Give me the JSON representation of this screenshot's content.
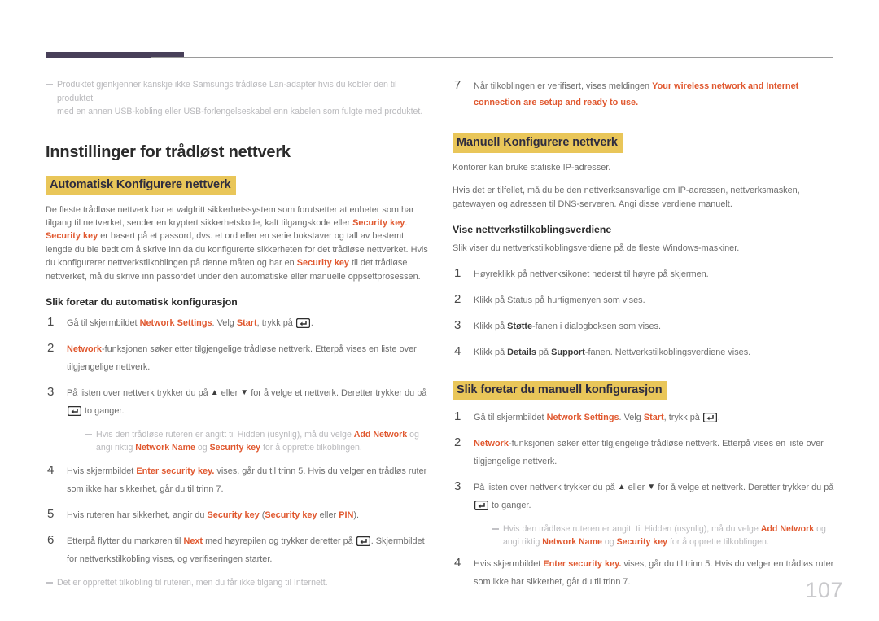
{
  "document": {
    "page_number": "107",
    "colors": {
      "accent": "#e0582f",
      "highlight_bg": "#e9c659",
      "highlight_text": "#2e2c3f",
      "rule_dark": "#484059",
      "rule_light": "#9a9a9a",
      "body_text": "#6d6d6d",
      "note_text": "#b9b9bc",
      "page_number": "#c9c9cc"
    },
    "icons": {
      "enter_key": "enter-key-icon",
      "arrow_up": "▲",
      "arrow_down": "▼",
      "note_dash": "note-dash-icon"
    }
  },
  "left_column": {
    "top_note": {
      "text_1": "Produktet gjenkjenner kanskje ikke Samsungs trådløse Lan-adapter hvis du kobler den til produktet",
      "text_2": "med en annen USB-kobling eller USB-forlengelseskabel enn kabelen som fulgte med produktet."
    },
    "title": "Innstillinger for trådløst nettverk",
    "section_heading": "Automatisk Konfigurere nettverk",
    "intro_paragraph": {
      "part_1": "De fleste trådløse nettverk har et valgfritt sikkerhetssystem som forutsetter at enheter som har tilgang til nettverket, sender en kryptert sikkerhetskode, kalt tilgangskode eller ",
      "term_1": "Security key",
      "part_2": ". ",
      "term_2": "Security key",
      "part_3": " er basert på et passord, dvs. et ord eller en serie bokstaver og tall av bestemt lengde du ble bedt om å skrive inn da du konfigurerte sikkerheten for det trådløse nettverket. Hvis du konfigurerer nettverkstilkoblingen på denne måten og har en ",
      "term_3": "Security key",
      "part_4": " til det trådløse nettverket, må du skrive inn passordet under den automatiske eller manuelle oppsettprosessen."
    },
    "subheading": "Slik foretar du automatisk konfigurasjon",
    "steps": {
      "s1": {
        "num": "1",
        "part_1": "Gå til skjermbildet ",
        "term_1": "Network Settings",
        "part_2": ". Velg ",
        "term_2": "Start",
        "part_3": ", trykk på ",
        "part_4": "."
      },
      "s2": {
        "num": "2",
        "term_1": "Network",
        "part_1": "-funksjonen søker etter tilgjengelige trådløse nettverk. Etterpå vises en liste over tilgjengelige nettverk."
      },
      "s3": {
        "num": "3",
        "part_1": "På listen over nettverk trykker du på ",
        "arrow_up": "▲",
        "part_2": " eller ",
        "arrow_down": "▼",
        "part_3": " for å velge et nettverk. Deretter trykker du på ",
        "part_4": " to ganger."
      },
      "note_hidden": {
        "part_1": "Hvis den trådløse ruteren er angitt til Hidden (usynlig), må du velge ",
        "term_1": "Add Network",
        "part_2": " og angi riktig ",
        "term_2": "Network Name",
        "part_3": " og ",
        "term_3": "Security key",
        "part_4": " for å opprette tilkoblingen."
      },
      "s4": {
        "num": "4",
        "part_1": "Hvis skjermbildet ",
        "term_1": "Enter security key.",
        "part_2": " vises, går du til trinn 5. Hvis du velger en trådløs ruter som ikke har sikkerhet, går du til trinn 7."
      },
      "s5": {
        "num": "5",
        "part_1": "Hvis ruteren har sikkerhet, angir du ",
        "term_1": "Security key",
        "part_2": " (",
        "term_2": "Security key",
        "part_3": " eller ",
        "term_3": "PIN",
        "part_4": ")."
      },
      "s6": {
        "num": "6",
        "part_1": "Etterpå flytter du markøren til ",
        "term_1": "Next",
        "part_2": " med høyrepilen og trykker deretter på ",
        "part_3": ". Skjermbildet for nettverkstilkobling vises, og verifiseringen starter."
      }
    },
    "bottom_note": "Det er opprettet tilkobling til ruteren, men du får ikke tilgang til Internett."
  },
  "right_column": {
    "step7": {
      "num": "7",
      "part_1": "Når tilkoblingen er verifisert, vises meldingen ",
      "term_1": "Your wireless network and Internet connection are setup and ready to use."
    },
    "section_heading": "Manuell Konfigurere nettverk",
    "paragraph_1": "Kontorer kan bruke statiske IP-adresser.",
    "paragraph_2": "Hvis det er tilfellet, må du be den nettverksansvarlige om IP-adressen, nettverksmasken, gatewayen og adressen til DNS-serveren. Angi disse verdiene manuelt.",
    "subheading_1": "Vise nettverkstilkoblingsverdiene",
    "paragraph_3": "Slik viser du nettverkstilkoblingsverdiene på de fleste Windows-maskiner.",
    "view_steps": {
      "v1": {
        "num": "1",
        "text": "Høyreklikk på nettverksikonet nederst til høyre på skjermen."
      },
      "v2": {
        "num": "2",
        "text": "Klikk på Status på hurtigmenyen som vises."
      },
      "v3": {
        "num": "3",
        "part_1": "Klikk på ",
        "term_1": "Støtte",
        "part_2": "-fanen i dialogboksen som vises."
      },
      "v4": {
        "num": "4",
        "part_1": "Klikk på ",
        "term_1": "Details",
        "part_2": " på ",
        "term_2": "Support",
        "part_3": "-fanen. Nettverkstilkoblingsverdiene vises."
      }
    },
    "manual_heading": "Slik foretar du manuell konfigurasjon",
    "manual_steps": {
      "m1": {
        "num": "1",
        "part_1": "Gå til skjermbildet ",
        "term_1": "Network Settings",
        "part_2": ". Velg ",
        "term_2": "Start",
        "part_3": ", trykk på ",
        "part_4": "."
      },
      "m2": {
        "num": "2",
        "term_1": "Network",
        "part_1": "-funksjonen søker etter tilgjengelige trådløse nettverk. Etterpå vises en liste over tilgjengelige nettverk."
      },
      "m3": {
        "num": "3",
        "part_1": "På listen over nettverk trykker du på ",
        "arrow_up": "▲",
        "part_2": " eller ",
        "arrow_down": "▼",
        "part_3": " for å velge et nettverk. Deretter trykker du på ",
        "part_4": " to ganger."
      },
      "note_hidden": {
        "part_1": "Hvis den trådløse ruteren er angitt til Hidden (usynlig), må du velge ",
        "term_1": "Add Network",
        "part_2": " og angi riktig ",
        "term_2": "Network Name",
        "part_3": " og ",
        "term_3": "Security key",
        "part_4": " for å opprette tilkoblingen."
      },
      "m4": {
        "num": "4",
        "part_1": "Hvis skjermbildet ",
        "term_1": "Enter security key.",
        "part_2": " vises, går du til trinn 5. Hvis du velger en trådløs ruter som ikke har sikkerhet, går du til trinn 7."
      }
    }
  }
}
